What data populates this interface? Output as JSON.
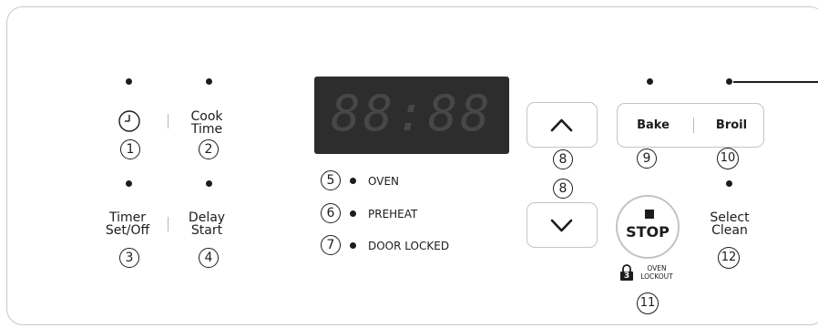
{
  "display": {
    "digits": "88:88"
  },
  "buttons": {
    "cook_time": [
      "Cook",
      "Time"
    ],
    "timer": [
      "Timer",
      "Set/Off"
    ],
    "delay_start": [
      "Delay",
      "Start"
    ],
    "bake": "Bake",
    "broil": "Broil",
    "stop": "STOP",
    "select_clean": [
      "Select",
      "Clean"
    ]
  },
  "indicators": {
    "oven": "OVEN",
    "preheat": "PREHEAT",
    "door_locked": "DOOR LOCKED"
  },
  "lockout": {
    "badge": "3",
    "line1": "OVEN",
    "line2": "LOCKOUT"
  },
  "callouts": [
    "1",
    "2",
    "3",
    "4",
    "5",
    "6",
    "7",
    "8",
    "8",
    "9",
    "10",
    "11",
    "12"
  ],
  "icons": [
    "clock-icon",
    "chevron-up-icon",
    "chevron-down-icon",
    "stop-square-icon",
    "lock-icon"
  ]
}
